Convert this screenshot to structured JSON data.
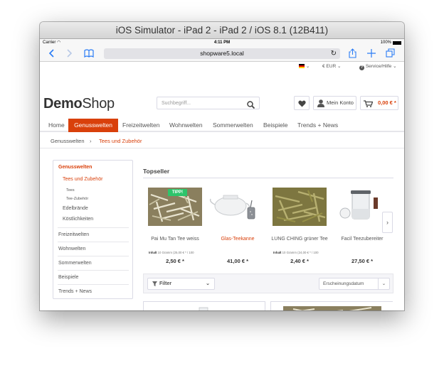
{
  "window": {
    "title": "iOS Simulator - iPad 2 - iPad 2 / iOS 8.1 (12B411)"
  },
  "status_bar": {
    "carrier": "Carrier",
    "time": "4:11 PM",
    "battery": "100%"
  },
  "browser": {
    "url": "shopware5.local",
    "icons": [
      "back-icon",
      "forward-icon",
      "bookmarks-icon",
      "reload-icon",
      "share-icon",
      "add-icon",
      "tabs-icon"
    ],
    "accent": "#2a7cf6"
  },
  "shop": {
    "accent": "#d9400b",
    "topbar": {
      "currency": "€ EUR",
      "service": "Service/Hilfe"
    },
    "logo": {
      "bold": "Demo",
      "light": "Shop"
    },
    "search": {
      "placeholder": "Suchbegriff..."
    },
    "account_label": "Mein Konto",
    "cart_price": "0,00 € *",
    "nav": [
      {
        "label": "Home"
      },
      {
        "label": "Genusswelten"
      },
      {
        "label": "Freizeitwelten"
      },
      {
        "label": "Wohnwelten"
      },
      {
        "label": "Sommerwelten"
      },
      {
        "label": "Beispiele"
      },
      {
        "label": "Trends + News"
      }
    ],
    "breadcrumb": [
      {
        "label": "Genusswelten"
      },
      {
        "label": "Tees und Zubehör"
      }
    ],
    "sidebar": {
      "main": "Genusswelten",
      "sub": [
        {
          "label": "Tees und Zubehör"
        },
        {
          "label": "Tees"
        },
        {
          "label": "Tee-Zubehör"
        },
        {
          "label": "Edelbrände"
        },
        {
          "label": "Köstlichkeiten"
        }
      ],
      "others": [
        {
          "label": "Freizeitwelten"
        },
        {
          "label": "Wohnwelten"
        },
        {
          "label": "Sommerwelten"
        },
        {
          "label": "Beispiele"
        },
        {
          "label": "Trends + News"
        }
      ]
    },
    "topseller": {
      "title": "Topseller",
      "badge": "TIPP!",
      "products": [
        {
          "name": "Pai Mu Tan Tee weiss",
          "unit_label": "Inhalt",
          "unit": "10 Gramm (25,00 € * / 100",
          "price": "2,50 € *"
        },
        {
          "name": "Glas-Teekanne",
          "unit_label": "",
          "unit": "",
          "price": "41,00 € *"
        },
        {
          "name": "LUNG CHING grüner Tee",
          "unit_label": "Inhalt",
          "unit": "10 Gramm (24,00 € * / 100",
          "price": "2,40 € *"
        },
        {
          "name": "Facil Teezubereiter",
          "unit_label": "",
          "unit": "",
          "price": "27,50 € *"
        }
      ]
    },
    "filter": {
      "label": "Filter",
      "sort_value": "Erscheinungsdatum"
    }
  }
}
